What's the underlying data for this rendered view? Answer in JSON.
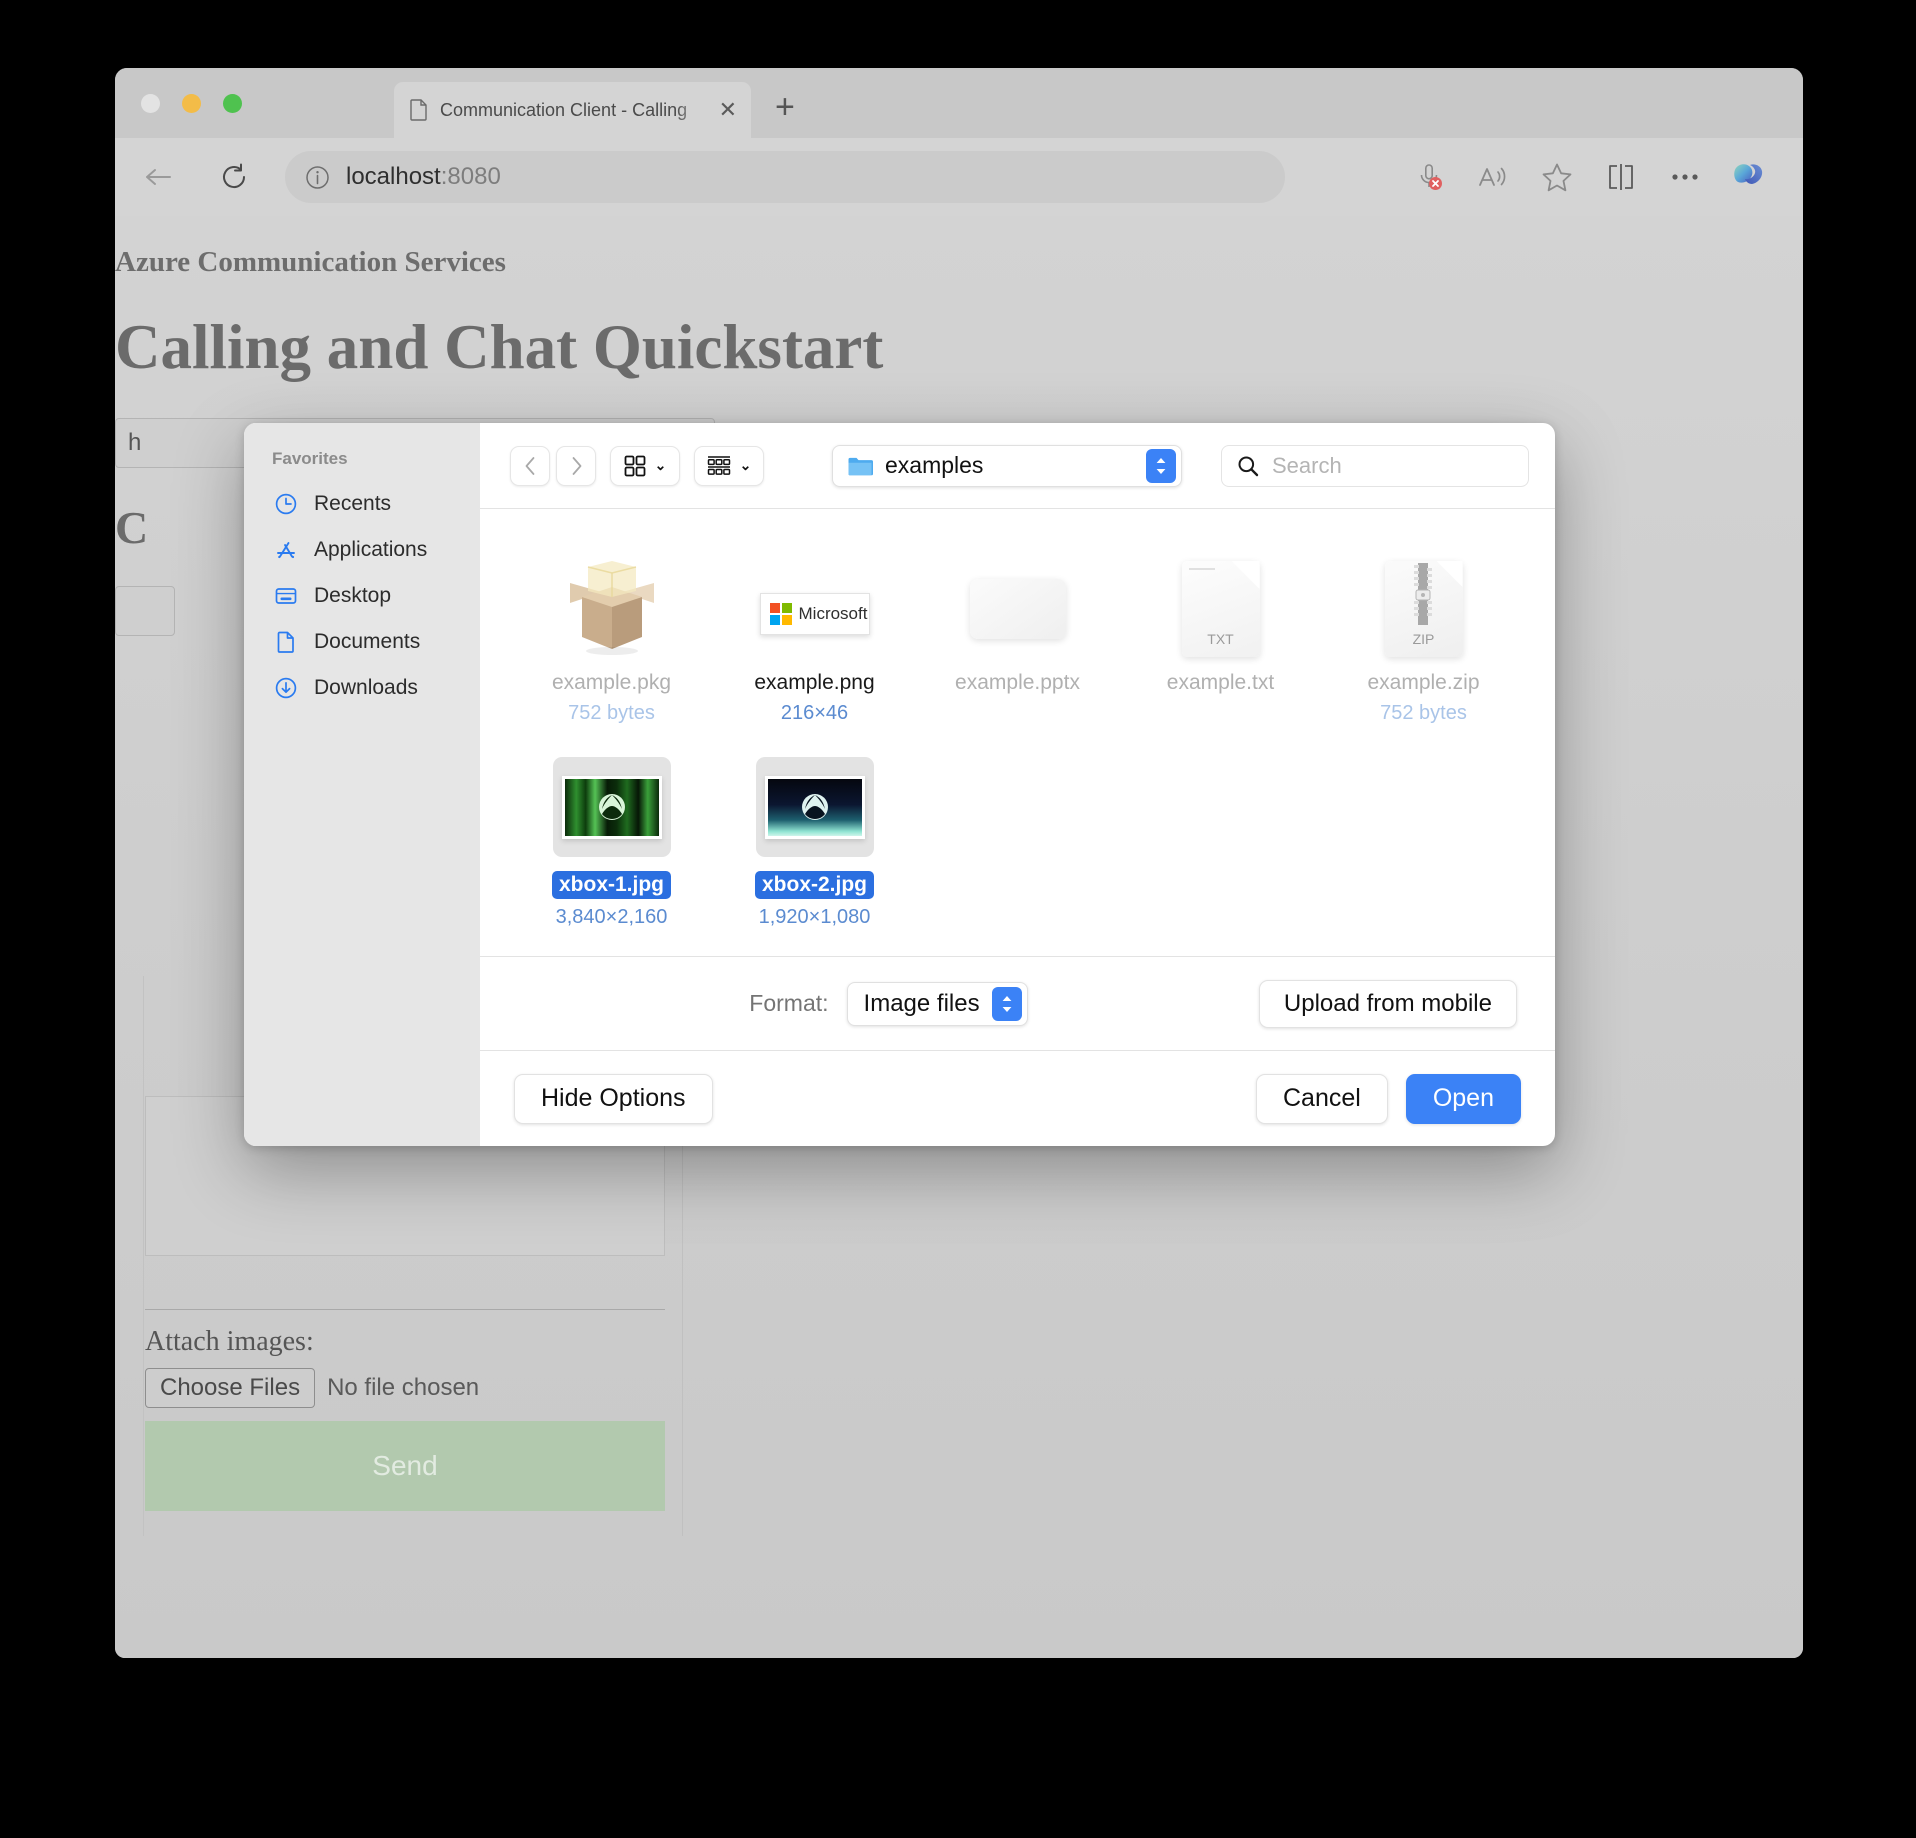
{
  "browser": {
    "tab": {
      "title": "Communication Client - Calling",
      "doc_icon": "document-icon",
      "close_icon": "close-icon"
    },
    "new_tab_label": "+",
    "back_icon": "back-arrow-icon",
    "reload_icon": "reload-icon",
    "address": {
      "info_icon": "info-icon",
      "host": "localhost",
      "port": ":8080"
    },
    "toolbar_icons": [
      {
        "name": "microphone-muted-icon"
      },
      {
        "name": "read-aloud-icon"
      },
      {
        "name": "favorites-star-icon"
      },
      {
        "name": "split-screen-icon"
      },
      {
        "name": "settings-more-icon"
      },
      {
        "name": "copilot-icon"
      }
    ]
  },
  "page": {
    "site_title": "Azure Communication Services",
    "heading": "Calling and Chat Quickstart",
    "token_value": "h",
    "display_heading": "C",
    "attach_label": "Attach images:",
    "choose_files_label": "Choose Files",
    "no_file_label": "No file chosen",
    "send_label": "Send"
  },
  "dialog": {
    "sidebar": {
      "section_label": "Favorites",
      "items": [
        {
          "label": "Recents",
          "icon": "clock-icon"
        },
        {
          "label": "Applications",
          "icon": "applications-icon"
        },
        {
          "label": "Desktop",
          "icon": "desktop-icon"
        },
        {
          "label": "Documents",
          "icon": "document-icon"
        },
        {
          "label": "Downloads",
          "icon": "download-circle-icon"
        }
      ]
    },
    "toolbar": {
      "back_icon": "chevron-left-icon",
      "forward_icon": "chevron-right-icon",
      "grid_view_icon": "grid-view-icon",
      "list_view_icon": "list-view-icon",
      "chevron": "⌄",
      "path": {
        "folder_icon": "folder-icon",
        "label": "examples",
        "stepper_icon": "stepper-updown-icon"
      },
      "search": {
        "icon": "search-icon",
        "placeholder": "Search"
      }
    },
    "files": [
      {
        "name": "example.pkg",
        "meta": "752 bytes",
        "icon": "package-box-icon",
        "enabled": false,
        "selected": false,
        "meta_dim": true
      },
      {
        "name": "example.png",
        "meta": "216×46",
        "icon": "microsoft-logo-image",
        "enabled": true,
        "selected": false,
        "meta_dim": false
      },
      {
        "name": "example.pptx",
        "meta": "",
        "icon": "blank-slide-icon",
        "enabled": false,
        "selected": false,
        "meta_dim": true
      },
      {
        "name": "example.txt",
        "meta": "",
        "icon": "text-document-icon",
        "enabled": false,
        "selected": false,
        "meta_dim": true
      },
      {
        "name": "example.zip",
        "meta": "752 bytes",
        "icon": "zip-archive-icon",
        "enabled": false,
        "selected": false,
        "meta_dim": true
      },
      {
        "name": "xbox-1.jpg",
        "meta": "3,840×2,160",
        "icon": "xbox-green-thumbnail",
        "enabled": true,
        "selected": true,
        "meta_dim": false
      },
      {
        "name": "xbox-2.jpg",
        "meta": "1,920×1,080",
        "icon": "xbox-blue-thumbnail",
        "enabled": true,
        "selected": true,
        "meta_dim": false
      }
    ],
    "icon_labels": {
      "txt": "TXT",
      "zip": "ZIP",
      "microsoft": "Microsoft"
    },
    "format": {
      "label": "Format:",
      "selected": "Image files",
      "stepper_icon": "stepper-updown-icon",
      "upload_mobile_label": "Upload from mobile"
    },
    "actions": {
      "hide_options_label": "Hide Options",
      "cancel_label": "Cancel",
      "open_label": "Open"
    }
  },
  "colors": {
    "accent_blue": "#3b82f6",
    "selection_blue": "#2b6fe0",
    "meta_blue": "#5b8bd0",
    "send_green": "#b2c9ae",
    "sidebar_bg": "#e6e6e6",
    "page_bg": "#d0d0d0"
  }
}
